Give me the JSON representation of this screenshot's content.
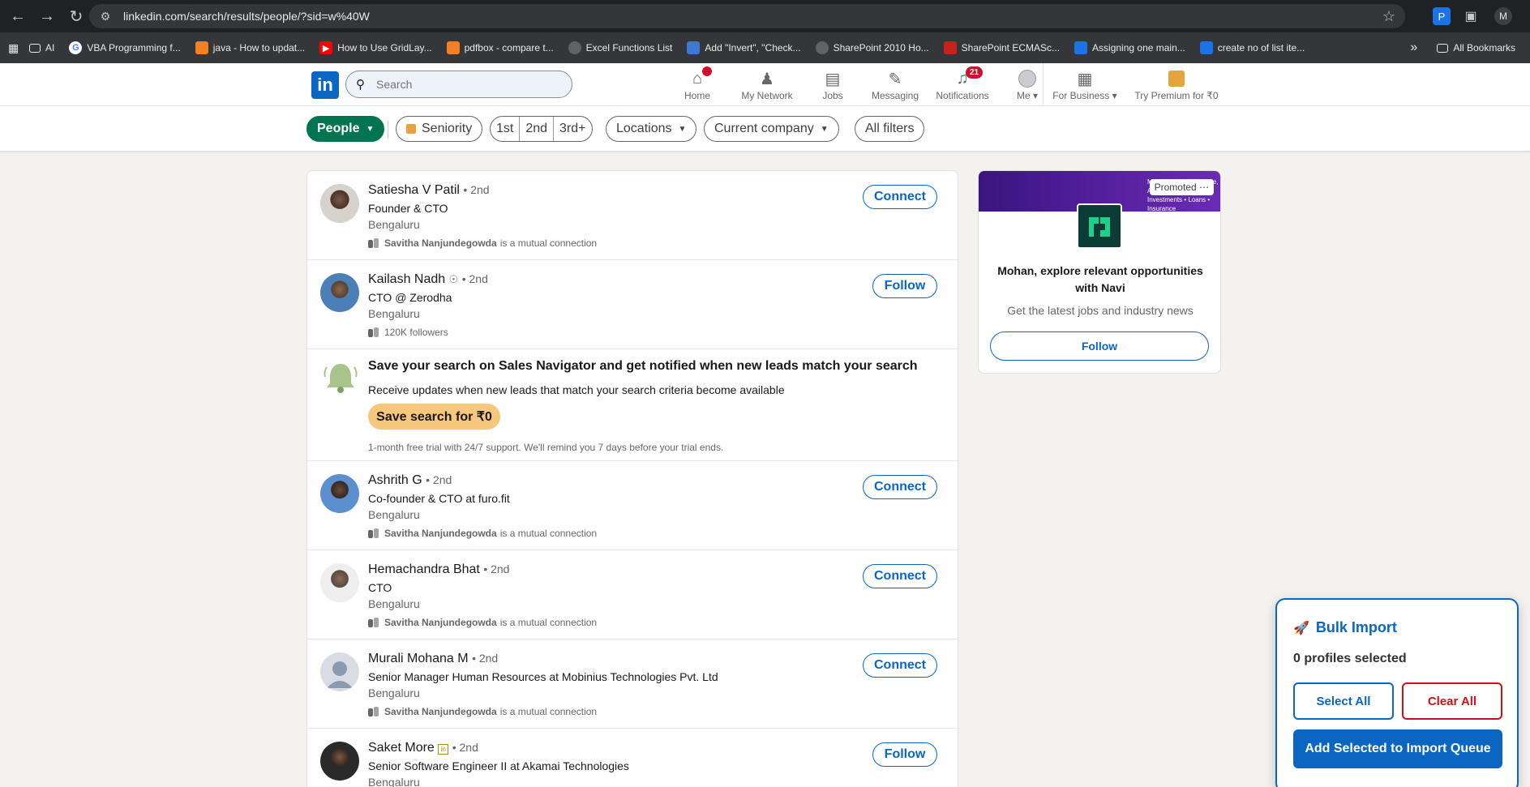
{
  "browser": {
    "url": "linkedin.com/search/results/people/?sid=w%40W",
    "profile_initial": "M",
    "bookmarks": [
      {
        "label": "AI",
        "icon": "folder-icon"
      },
      {
        "label": "VBA Programming f...",
        "icon": "google-icon"
      },
      {
        "label": "java - How to updat...",
        "icon": "stackoverflow-icon"
      },
      {
        "label": "How to Use GridLay...",
        "icon": "youtube-icon"
      },
      {
        "label": "pdfbox - compare t...",
        "icon": "stackoverflow-icon"
      },
      {
        "label": "Excel Functions List",
        "icon": "globe-icon"
      },
      {
        "label": "Add \"Invert\", \"Check...",
        "icon": "doc-icon"
      },
      {
        "label": "SharePoint 2010 Ho...",
        "icon": "globe-icon"
      },
      {
        "label": "SharePoint ECMASc...",
        "icon": "site-icon"
      },
      {
        "label": "Assigning one main...",
        "icon": "stackoverflow-icon"
      },
      {
        "label": "create no of list ite...",
        "icon": "stackoverflow-icon"
      }
    ],
    "all_bookmarks": "All Bookmarks"
  },
  "header": {
    "search_placeholder": "Search",
    "nav": [
      {
        "label": "Home",
        "icon": "home-icon",
        "badge": ""
      },
      {
        "label": "My Network",
        "icon": "network-icon",
        "badge": ""
      },
      {
        "label": "Jobs",
        "icon": "briefcase-icon",
        "badge": ""
      },
      {
        "label": "Messaging",
        "icon": "message-icon",
        "badge": ""
      },
      {
        "label": "Notifications",
        "icon": "bell-icon",
        "badge": "21"
      },
      {
        "label": "Me",
        "icon": "avatar-icon",
        "badge": ""
      }
    ],
    "for_business": "For Business",
    "premium": "Try Premium for ₹0"
  },
  "filters": {
    "people": "People",
    "seniority": "Seniority",
    "degrees": [
      "1st",
      "2nd",
      "3rd+"
    ],
    "locations": "Locations",
    "current_company": "Current company",
    "all_filters": "All filters"
  },
  "results": [
    {
      "name": "Satiesha V Patil",
      "degree": "• 2nd",
      "title": "Founder & CTO",
      "location": "Bengaluru",
      "mutual_name": "Savitha Nanjundegowda",
      "mutual_text": "is a mutual connection",
      "action": "Connect"
    },
    {
      "name": "Kailash Nadh",
      "degree": "• 2nd",
      "title": "CTO @ Zerodha",
      "location": "Bengaluru",
      "mutual_name": "",
      "mutual_text": "120K followers",
      "action": "Follow"
    },
    {
      "name": "Ashrith G",
      "degree": "• 2nd",
      "title": "Co-founder & CTO at furo.fit",
      "location": "Bengaluru",
      "mutual_name": "Savitha Nanjundegowda",
      "mutual_text": "is a mutual connection",
      "action": "Connect"
    },
    {
      "name": "Hemachandra Bhat",
      "degree": "• 2nd",
      "title": "CTO",
      "location": "Bengaluru",
      "mutual_name": "Savitha Nanjundegowda",
      "mutual_text": "is a mutual connection",
      "action": "Connect"
    },
    {
      "name": "Murali Mohana M",
      "degree": "• 2nd",
      "title": "Senior Manager Human Resources at Mobinius Technologies Pvt. Ltd",
      "location": "Bengaluru",
      "mutual_name": "Savitha Nanjundegowda",
      "mutual_text": "is a mutual connection",
      "action": "Connect"
    },
    {
      "name": "Saket More",
      "degree": "• 2nd",
      "title": "Senior Software Engineer II at Akamai Technologies",
      "location": "Bengaluru",
      "mutual_name": "",
      "mutual_text": "",
      "action": "Follow"
    }
  ],
  "sales_nav": {
    "title": "Save your search on Sales Navigator and get notified when new leads match your search",
    "subtitle": "Receive updates when new leads that match your search criteria become available",
    "button": "Save search for ₹0",
    "note": "1-month free trial with 24/7 support. We'll remind you 7 days before your trial ends."
  },
  "promo": {
    "tag": "Promoted",
    "banner_text": "Making Financ... Simple, Afford... UPI • Investments • Loans • Insurance",
    "headline": "Mohan, explore relevant opportunities with Navi",
    "sub": "Get the latest jobs and industry news",
    "follow": "Follow"
  },
  "bulk_import": {
    "title": "Bulk Import",
    "count": "0 profiles selected",
    "select_all": "Select All",
    "clear_all": "Clear All",
    "add_queue": "Add Selected to Import Queue"
  },
  "colors": {
    "linkedin_blue": "#0a66c2",
    "people_green": "#01754f",
    "premium_gold": "#f8c77e",
    "danger_red": "#cc1016"
  }
}
